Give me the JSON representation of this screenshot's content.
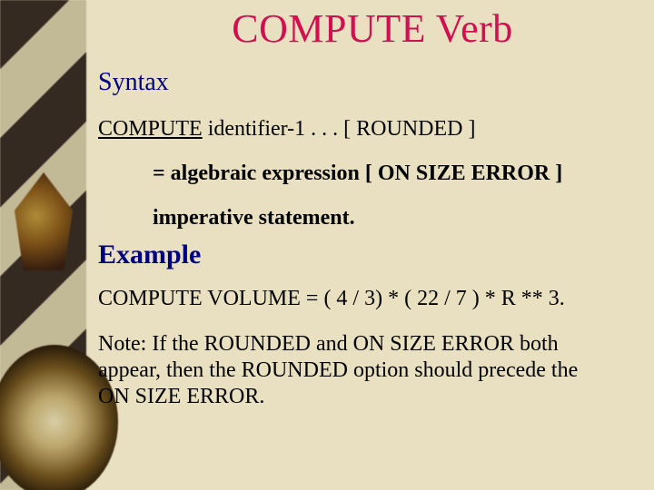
{
  "title": "COMPUTE Verb",
  "sections": {
    "syntax_heading": "Syntax",
    "syntax": {
      "keyword": "COMPUTE",
      "rest_line1": "  identifier-1 .  .  .   [ ROUNDED ]",
      "line2": "=   algebraic expression  [ ON SIZE ERROR ]",
      "line3": "imperative statement."
    },
    "example_heading": "Example",
    "example": "COMPUTE  VOLUME =  ( 4 / 3) * ( 22 / 7 ) * R ** 3.",
    "note": "Note: If the ROUNDED and ON SIZE ERROR both appear, then the ROUNDED option should precede the ON SIZE ERROR."
  }
}
